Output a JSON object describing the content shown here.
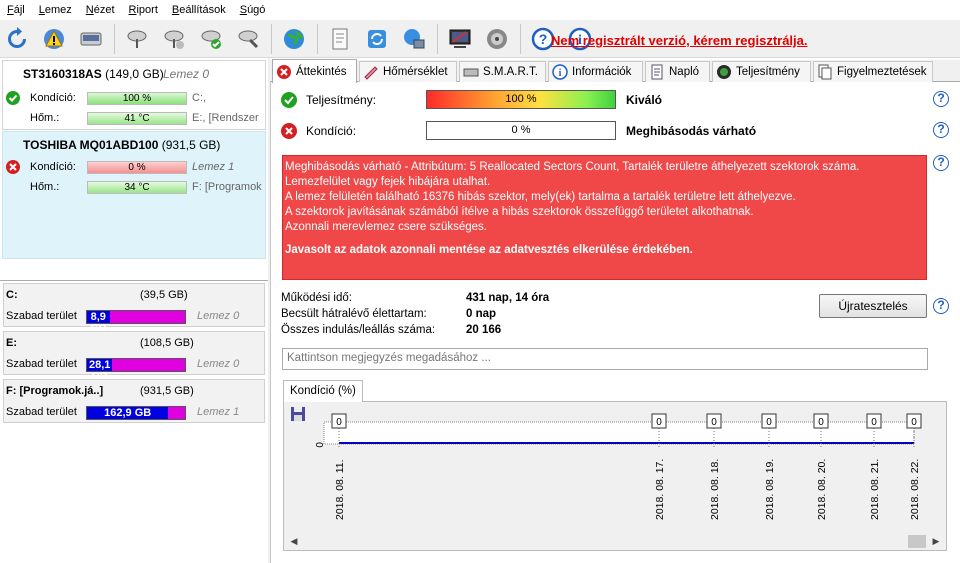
{
  "menu": {
    "items": [
      "Fájl",
      "Lemez",
      "Nézet",
      "Riport",
      "Beállítások",
      "Súgó"
    ]
  },
  "toolbar": {
    "unregistered": "Nem regisztrált verzió, kérem regisztrálja."
  },
  "disks": [
    {
      "name": "ST3160318AS",
      "size": "(149,0 GB)",
      "lemez": "Lemez 0",
      "rows": [
        {
          "label": "Kondíció:",
          "value": "100 %",
          "drive": "C:,"
        },
        {
          "label": "Hőm.:",
          "value": "41 °C",
          "drive": "E:, [Rendszer"
        }
      ]
    },
    {
      "name": "TOSHIBA MQ01ABD100",
      "size": "(931,5 GB)",
      "lemez": "Lemez 1",
      "rows": [
        {
          "label": "Kondíció:",
          "value": "0 %",
          "drive": "Lemez 1"
        },
        {
          "label": "Hőm.:",
          "value": "34 °C",
          "drive": "F: [Programok"
        }
      ]
    }
  ],
  "volumes": [
    {
      "name": "C:",
      "size": "(39,5 GB)",
      "free_label": "Szabad terület",
      "free": "8,9 GB",
      "free_fraction": 0.23,
      "lemez": "Lemez 0"
    },
    {
      "name": "E:",
      "size": "(108,5 GB)",
      "free_label": "Szabad terület",
      "free": "28,1 GB",
      "free_fraction": 0.26,
      "lemez": "Lemez 0"
    },
    {
      "name": "F: [Programok.já..]",
      "size": "(931,5 GB)",
      "free_label": "Szabad terület",
      "free": "162,9 GB",
      "free_fraction": 0.83,
      "lemez": "Lemez 1"
    }
  ],
  "tabs": [
    "Áttekintés",
    "Hőmérséklet",
    "S.M.A.R.T.",
    "Információk",
    "Napló",
    "Teljesítmény",
    "Figyelmeztetések"
  ],
  "overview": {
    "perf_label": "Teljesítmény:",
    "perf_value": "100 %",
    "perf_text": "Kiváló",
    "health_label": "Kondíció:",
    "health_value": "0 %",
    "health_text": "Meghibásodás várható",
    "alert_lines": [
      "Meghibásodás várható - Attribútum: 5 Reallocated Sectors Count, Tartalék területre áthelyezett szektorok száma.",
      "Lemezfelület vagy fejek hibájára utalhat.",
      "A lemez felületén található 16376 hibás szektor, mely(ek) tartalma a tartalék területre lett áthelyezve.",
      "A szektorok javításának számából ítélve a hibás szektorok összefüggő területet alkothatnak.",
      "Azonnali merevlemez csere szükséges."
    ],
    "alert_advice": "Javasolt az adatok azonnali mentése az adatvesztés elkerülése érdekében.",
    "stats": [
      {
        "key": "Működési idő:",
        "value": "431 nap, 14 óra"
      },
      {
        "key": "Becsült hátralévő élettartam:",
        "value": "0 nap"
      },
      {
        "key": "Összes indulás/leállás száma:",
        "value": "20 166"
      }
    ],
    "retest": "Újratesztelés",
    "note_placeholder": "Kattintson megjegyzés megadásához ...",
    "help": "?"
  },
  "chart_data": {
    "type": "line",
    "tab_label": "Kondíció  (%)",
    "x": [
      "2018. 08. 11.",
      "2018. 08. 17.",
      "2018. 08. 18.",
      "2018. 08. 19.",
      "2018. 08. 20.",
      "2018. 08. 21.",
      "2018. 08. 22."
    ],
    "values": [
      0,
      0,
      0,
      0,
      0,
      0,
      0
    ],
    "y_tick": "0",
    "color": "#0000c0"
  }
}
